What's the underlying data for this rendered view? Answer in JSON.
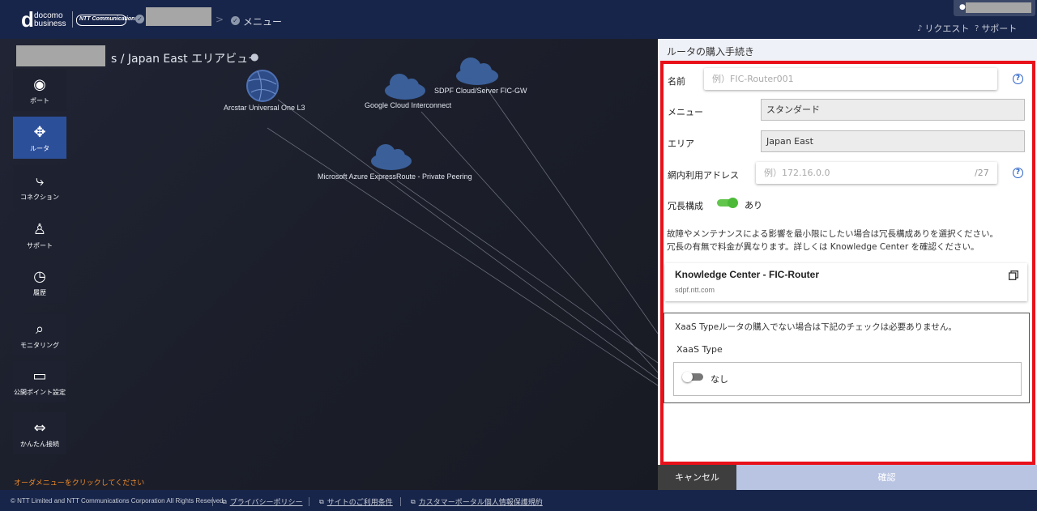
{
  "header": {
    "logo_d": "d",
    "logo_line1": "docomo",
    "logo_line2": "business",
    "ntt_logo_text": "NTT Communications",
    "breadcrumb_separator": ">",
    "breadcrumb_menu": "メニュー",
    "request_label": "リクエスト",
    "support_label": "サポート",
    "icons": {
      "request": "bell-icon",
      "support": "help-icon",
      "user": "user-icon",
      "check": "check-circle-icon"
    }
  },
  "area": {
    "title_suffix": "s / Japan East エリアビュー",
    "order_note": "オーダメニューをクリックしてください"
  },
  "sidebar": {
    "items": [
      {
        "label": "ポート",
        "icon": "port-icon"
      },
      {
        "label": "ルータ",
        "icon": "router-icon",
        "active": true
      },
      {
        "label": "コネクション",
        "icon": "connection-icon"
      },
      {
        "label": "サポート",
        "icon": "support-icon"
      },
      {
        "label": "履歴",
        "icon": "history-icon"
      },
      {
        "label": "モニタリング",
        "icon": "monitoring-icon"
      },
      {
        "label": "公開ポイント設定",
        "icon": "public-point-icon"
      },
      {
        "label": "かんたん接続",
        "icon": "easy-connect-icon"
      }
    ]
  },
  "network": {
    "nodes": [
      {
        "label": "Arcstar Universal One L3",
        "icon": "globe-icon"
      },
      {
        "label": "Google Cloud Interconnect",
        "icon": "cloud-icon"
      },
      {
        "label": "SDPF Cloud/Server FIC-GW",
        "icon": "cloud-icon"
      },
      {
        "label": "Microsoft Azure ExpressRoute - Private Peering",
        "icon": "cloud-icon"
      }
    ]
  },
  "form": {
    "panel_title": "ルータの購入手続き",
    "name_label": "名前",
    "name_placeholder": "例）FIC-Router001",
    "menu_label": "メニュー",
    "menu_value": "スタンダード",
    "area_label": "エリア",
    "area_value": "Japan East",
    "address_label": "網内利用アドレス",
    "address_placeholder": "例）172.16.0.0",
    "address_suffix": "/27",
    "redundancy_label": "冗長構成",
    "redundancy_value": "あり",
    "redundancy_on": true,
    "description_line1": "故障やメンテナンスによる影響を最小限にしたい場合は冗長構成ありを選択ください。",
    "description_line2": "冗長の有無で料金が異なります。詳しくは Knowledge Center を確認ください。",
    "kc_title": "Knowledge Center - FIC-Router",
    "kc_url": "sdpf.ntt.com",
    "xaas_note": "XaaS Typeルータの購入でない場合は下記のチェックは必要ありません。",
    "xaas_label": "XaaS Type",
    "xaas_value": "なし",
    "xaas_on": false,
    "help_glyph": "?",
    "cancel_label": "キャンセル",
    "confirm_label": "確認"
  },
  "footer": {
    "copyright": "© NTT Limited and NTT Communications Corporation All Rights Reserved.",
    "privacy_label": "プライバシーポリシー",
    "terms_label": "サイトのご利用条件",
    "customer_privacy_label": "カスタマーポータル個人情報保護規約"
  },
  "colors": {
    "header_bg": "#18254a",
    "active_menu": "#2c4f9a",
    "highlight_border": "#e8111a",
    "toggle_on": "#4cba38",
    "order_note": "#f08a2a"
  }
}
